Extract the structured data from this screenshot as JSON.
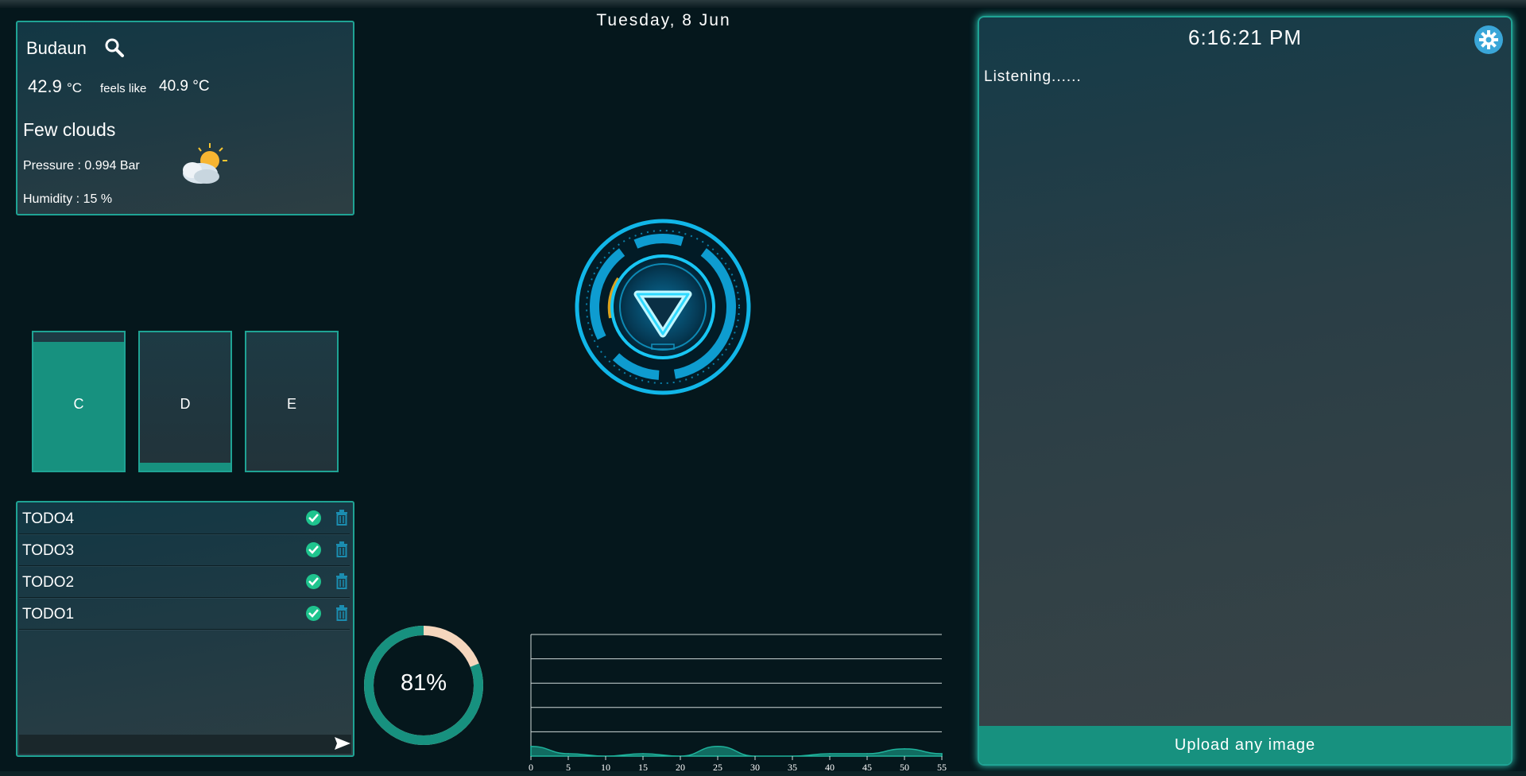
{
  "weather": {
    "city": "Budaun",
    "temp": "42.9",
    "temp_unit": "°C",
    "feels_label": "feels like",
    "feels": "40.9 °C",
    "description": "Few clouds",
    "pressure": "Pressure : 0.994 Bar",
    "humidity": "Humidity : 15 %",
    "icon": "partly-cloudy-sun"
  },
  "drives": [
    {
      "label": "C",
      "used_fraction": 0.93
    },
    {
      "label": "D",
      "used_fraction": 0.06
    },
    {
      "label": "E",
      "used_fraction": 0.0
    }
  ],
  "todos": [
    {
      "text": "TODO4"
    },
    {
      "text": "TODO3"
    },
    {
      "text": "TODO2"
    },
    {
      "text": "TODO1"
    }
  ],
  "date": "Tuesday, 8 Jun",
  "gauge": {
    "label": "81%",
    "value": 81
  },
  "chart_data": {
    "type": "area",
    "x": [
      0,
      5,
      10,
      15,
      20,
      25,
      30,
      35,
      40,
      45,
      50,
      55
    ],
    "values": [
      4,
      1,
      0,
      1,
      0,
      4,
      0,
      0,
      1,
      1,
      3,
      1
    ],
    "x_ticks": [
      "0",
      "5",
      "10",
      "15",
      "20",
      "25",
      "30",
      "35",
      "40",
      "45",
      "50",
      "55"
    ],
    "ylim": [
      0,
      50
    ],
    "grid": true
  },
  "assistant": {
    "clock": "6:16:21 PM",
    "status": "Listening......",
    "upload_label": "Upload any image"
  },
  "colors": {
    "accent": "#17917f",
    "border": "#1fa394",
    "glow": "#2fd4c0",
    "gauge_rest": "#f5d6bd"
  }
}
